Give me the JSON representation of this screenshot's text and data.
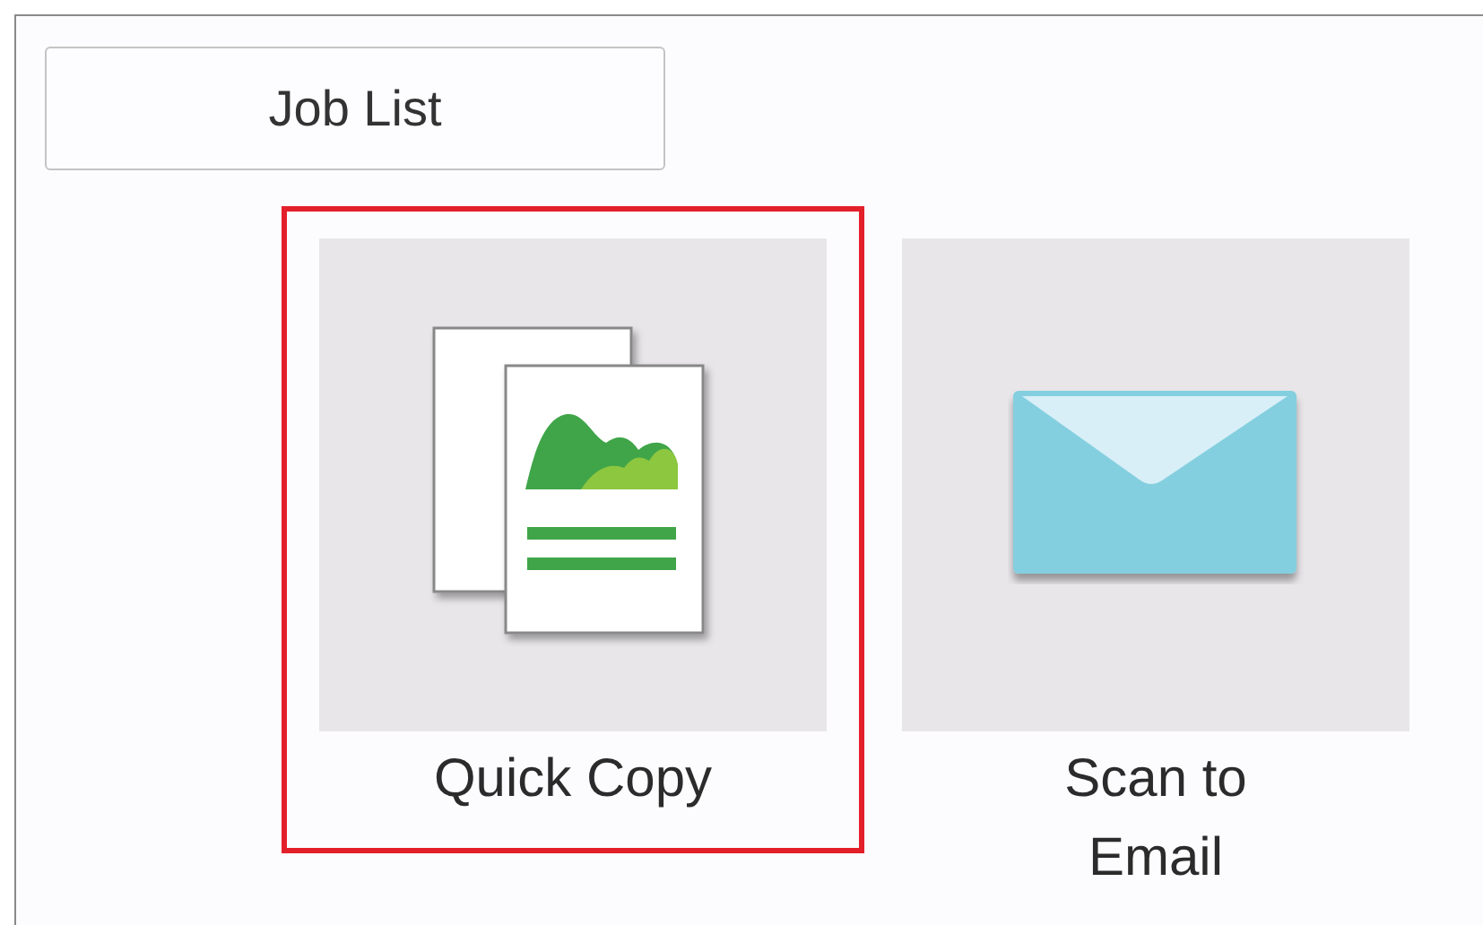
{
  "job_list_button": {
    "label": "Job List"
  },
  "tiles": [
    {
      "kind": "copy",
      "label": "Quick Copy",
      "selected": true
    },
    {
      "kind": "email",
      "label": "Scan to Email",
      "selected": false
    }
  ]
}
